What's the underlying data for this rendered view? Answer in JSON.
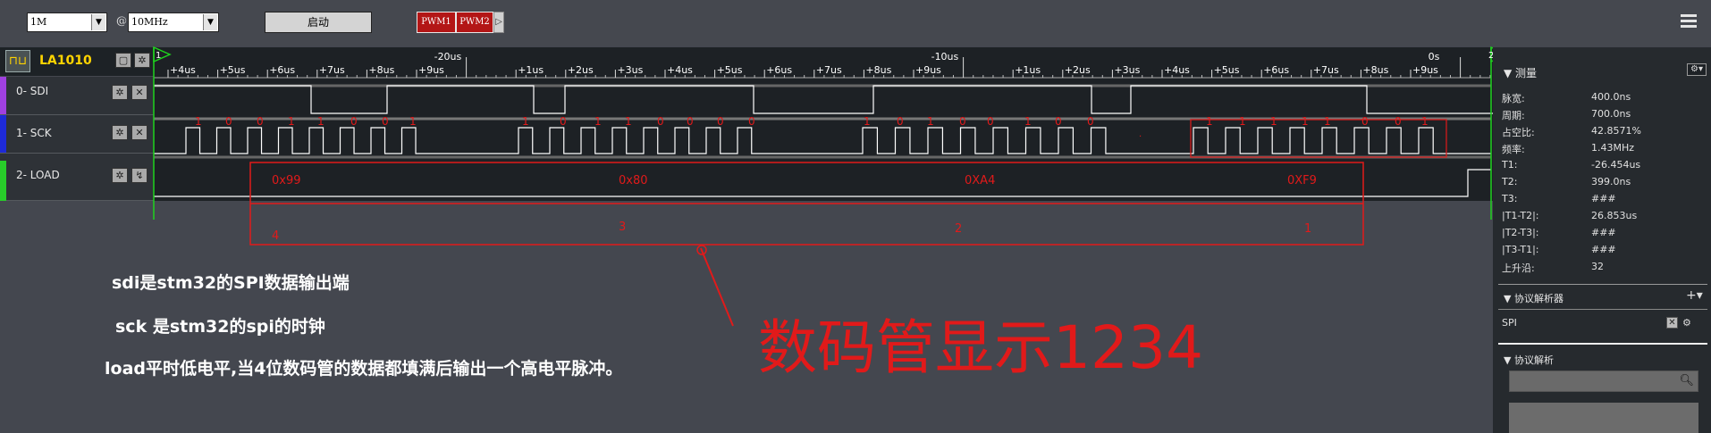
{
  "toolbar": {
    "depth": "1M",
    "at": "@",
    "rate": "10MHz",
    "start_label": "启动",
    "pwm1": "PWM1",
    "pwm2": "PWM2"
  },
  "device": {
    "name": "LA1010"
  },
  "channels": [
    {
      "label": "0- SDI",
      "color": "#a040e0"
    },
    {
      "label": "1- SCK",
      "color": "#1e2ad8"
    },
    {
      "label": "2- LOAD",
      "color": "#28cc2a"
    }
  ],
  "timeline": {
    "ticks": [
      "+4us",
      "+5us",
      "+6us",
      "+7us",
      "+8us",
      "+9us",
      "-20us",
      "+1us",
      "+2us",
      "+3us",
      "+4us",
      "+5us",
      "+6us",
      "+7us",
      "+8us",
      "+9us",
      "-10us",
      "+1us",
      "+2us",
      "+3us",
      "+4us",
      "+5us",
      "+6us",
      "+7us",
      "+8us",
      "+9us",
      "0s"
    ],
    "marker1": "1",
    "marker2": "2"
  },
  "annotations": {
    "bits": [
      "1",
      "0",
      "0",
      "1",
      "1",
      "0",
      "0",
      "1",
      "1",
      "0",
      "1",
      "1",
      "0",
      "0",
      "0",
      "0",
      "1",
      "0",
      "1",
      "0",
      "0",
      "1",
      "0",
      "0",
      "1",
      "1",
      "1",
      "1",
      "1",
      "0",
      "0",
      "1"
    ],
    "hex": [
      "0x99",
      "0x80",
      "0XA4",
      "0XF9"
    ],
    "digits": [
      "4",
      "3",
      "2",
      "1"
    ],
    "dot": "·",
    "big_text": "数码管显示1234",
    "notes": [
      "sdi是stm32的SPI数据输出端",
      "sck 是stm32的spi的时钟",
      "load平时低电平,当4位数码管的数据都填满后输出一个高电平脉冲。"
    ]
  },
  "measure": {
    "title": "测量",
    "rows": [
      {
        "label": "脉宽:",
        "value": "400.0ns"
      },
      {
        "label": "周期:",
        "value": "700.0ns"
      },
      {
        "label": "占空比:",
        "value": "42.8571%"
      },
      {
        "label": "频率:",
        "value": "1.43MHz"
      },
      {
        "label": "T1:",
        "value": "-26.454us"
      },
      {
        "label": "T2:",
        "value": "399.0ns"
      },
      {
        "label": "T3:",
        "value": "###"
      },
      {
        "label": "|T1-T2|:",
        "value": "26.853us"
      },
      {
        "label": "|T2-T3|:",
        "value": "###"
      },
      {
        "label": "|T3-T1|:",
        "value": "###"
      },
      {
        "label": "上升沿:",
        "value": "32"
      }
    ]
  },
  "decoder": {
    "title": "协议解析器",
    "item": "SPI"
  },
  "protocol": {
    "title": "协议解析"
  },
  "colors": {
    "accent_red": "#e11a1a",
    "cursor_green": "#1ed21e",
    "trace": "#ffffff",
    "background": "#44474f"
  }
}
